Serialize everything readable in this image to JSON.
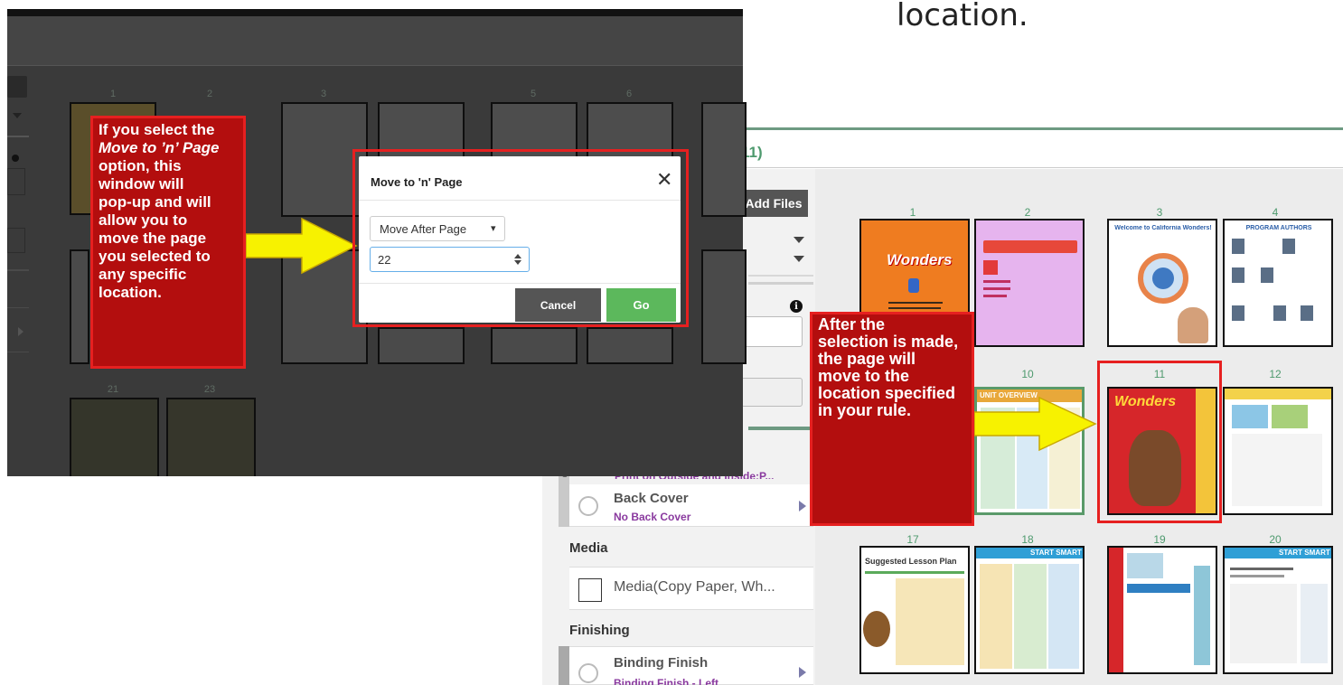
{
  "slide": {
    "caption": "location."
  },
  "left_screenshot": {
    "page_numbers": [
      "1",
      "2",
      "3",
      "5",
      "6",
      "21",
      "23"
    ],
    "callout": {
      "line1": "If you select the",
      "line2_italic": "Move to ’n’ Page",
      "lines": [
        "option, this",
        "window will",
        "pop-up and will",
        "allow you to",
        "move the page",
        "you selected to",
        "any specific",
        "location."
      ]
    },
    "modal": {
      "title": "Move to 'n' Page",
      "close_glyph": "✕",
      "select_value": "Move After Page",
      "select_caret": "▾",
      "number_value": "22",
      "cancel_label": "Cancel",
      "go_label": "Go"
    }
  },
  "right_screenshot": {
    "header_text": "11)",
    "add_files_label": "Add Files",
    "info_glyph": "i",
    "sidebar": {
      "print_option_text": "Print on Outside and Inside:P...",
      "back_cover": {
        "title": "Back Cover",
        "subtitle": "No Back Cover"
      },
      "media_heading": "Media",
      "media_option": "Media(Copy Paper, Wh...",
      "finishing_heading": "Finishing",
      "binding": {
        "title": "Binding Finish",
        "subtitle": "Binding Finish - Left"
      },
      "marker": "1"
    },
    "page_numbers": [
      "1",
      "2",
      "3",
      "4",
      "10",
      "11",
      "12",
      "17",
      "18",
      "19",
      "20"
    ],
    "thumb_texts": {
      "wonders": "Wonders",
      "unit_overview": "UNIT OVERVIEW",
      "start_smart": "START SMART",
      "suggested_lesson": "Suggested Lesson Plan",
      "welcome": "Welcome to California Wonders!",
      "authors": "PROGRAM AUTHORS"
    },
    "callout": {
      "lines": [
        "After the",
        "selection is made,",
        "the page will",
        "move to the",
        "location specified",
        "in your rule."
      ]
    }
  },
  "colors": {
    "callout_red": "#b30e0e",
    "frame_red": "#e62020",
    "arrow_yellow": "#f7f200",
    "go_green": "#5cb85c",
    "accent_green": "#4e9a6e"
  }
}
